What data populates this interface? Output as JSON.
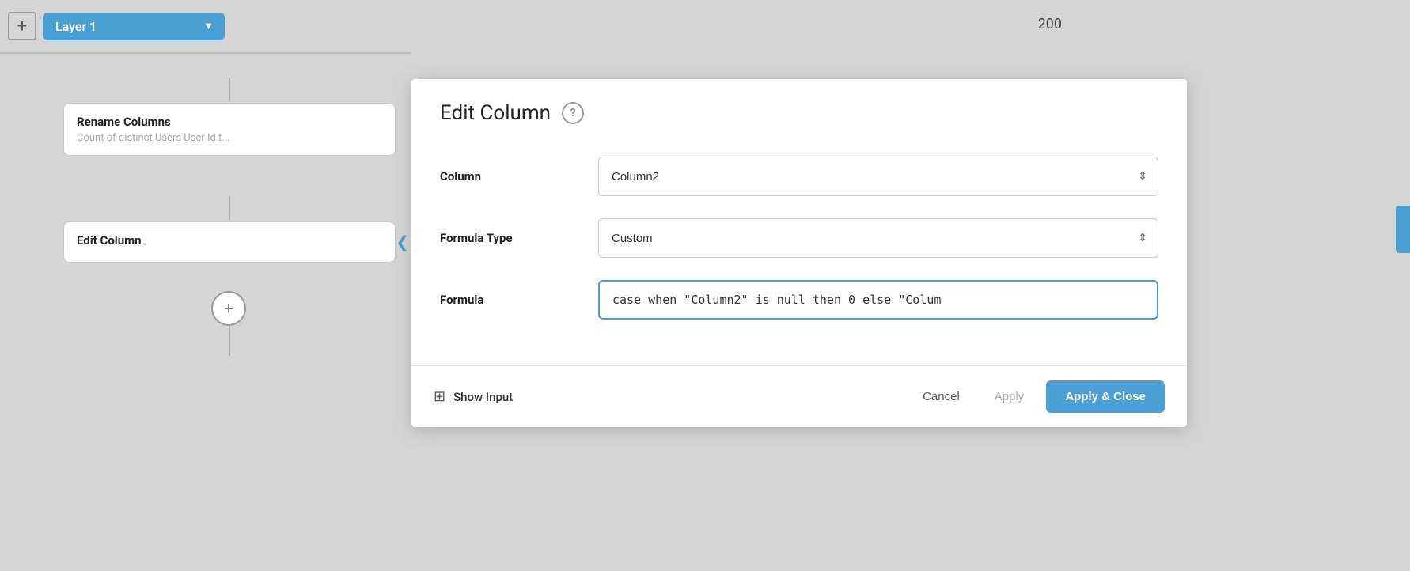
{
  "canvas": {
    "background_color": "#d5d5d5"
  },
  "topbar": {
    "add_label": "+",
    "layer_name": "Layer 1",
    "dropdown_arrow": "▼"
  },
  "column_number": "200",
  "nodes": {
    "rename": {
      "title": "Rename Columns",
      "subtitle": "Count of distinct Users User Id t..."
    },
    "edit": {
      "title": "Edit Column"
    }
  },
  "modal": {
    "title": "Edit Column",
    "help_icon": "?",
    "fields": {
      "column": {
        "label": "Column",
        "value": "Column2"
      },
      "formula_type": {
        "label": "Formula Type",
        "value": "Custom"
      },
      "formula": {
        "label": "Formula",
        "value": "case when \"Column2\" is null then 0 else \"Colum"
      }
    },
    "footer": {
      "show_input_label": "Show Input",
      "cancel_label": "Cancel",
      "apply_label": "Apply",
      "apply_close_label": "Apply & Close"
    }
  }
}
